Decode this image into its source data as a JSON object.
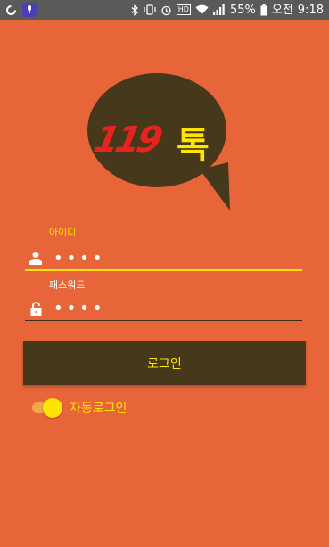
{
  "status_bar": {
    "app_badge_label": "앱",
    "battery_percent": "55%",
    "period": "오전",
    "time": "9:18",
    "hd_label": "HD"
  },
  "logo": {
    "number": "119",
    "word": "톡"
  },
  "login": {
    "id_label": "아이디",
    "id_value": "••••",
    "pw_label": "패스워드",
    "pw_value": "••••",
    "button_label": "로그인",
    "auto_login_label": "자동로그인",
    "auto_login_enabled": true
  },
  "colors": {
    "background": "#e8653a",
    "accent": "#ffe400",
    "bubble": "#46381a",
    "logo_number": "#e8221d"
  }
}
